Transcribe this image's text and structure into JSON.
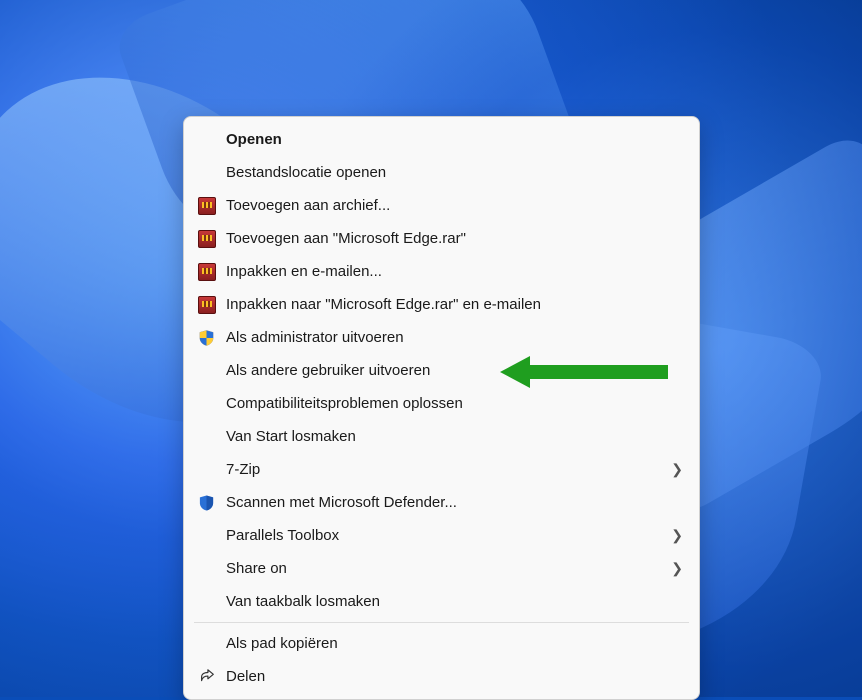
{
  "menu": {
    "items": [
      {
        "label": "Openen",
        "icon": null,
        "bold": true,
        "submenu": false
      },
      {
        "label": "Bestandslocatie openen",
        "icon": null,
        "submenu": false
      },
      {
        "label": "Toevoegen aan archief...",
        "icon": "winrar",
        "submenu": false
      },
      {
        "label": "Toevoegen aan \"Microsoft Edge.rar\"",
        "icon": "winrar",
        "submenu": false
      },
      {
        "label": "Inpakken en e-mailen...",
        "icon": "winrar",
        "submenu": false
      },
      {
        "label": "Inpakken naar \"Microsoft Edge.rar\" en e-mailen",
        "icon": "winrar",
        "submenu": false
      },
      {
        "label": "Als administrator uitvoeren",
        "icon": "uac-shield",
        "submenu": false
      },
      {
        "label": "Als andere gebruiker uitvoeren",
        "icon": null,
        "submenu": false,
        "highlighted": true
      },
      {
        "label": "Compatibiliteitsproblemen oplossen",
        "icon": null,
        "submenu": false
      },
      {
        "label": "Van Start losmaken",
        "icon": null,
        "submenu": false
      },
      {
        "label": "7-Zip",
        "icon": null,
        "submenu": true
      },
      {
        "label": "Scannen met Microsoft Defender...",
        "icon": "defender-shield",
        "submenu": false
      },
      {
        "label": "Parallels Toolbox",
        "icon": null,
        "submenu": true
      },
      {
        "label": "Share on",
        "icon": null,
        "submenu": true
      },
      {
        "label": "Van taakbalk losmaken",
        "icon": null,
        "submenu": false
      },
      {
        "separator": true
      },
      {
        "label": "Als pad kopiëren",
        "icon": null,
        "submenu": false
      },
      {
        "label": "Delen",
        "icon": "share",
        "submenu": false
      }
    ]
  },
  "annotation": {
    "type": "arrow",
    "color": "#1f9e1f",
    "target_item_index": 7
  }
}
